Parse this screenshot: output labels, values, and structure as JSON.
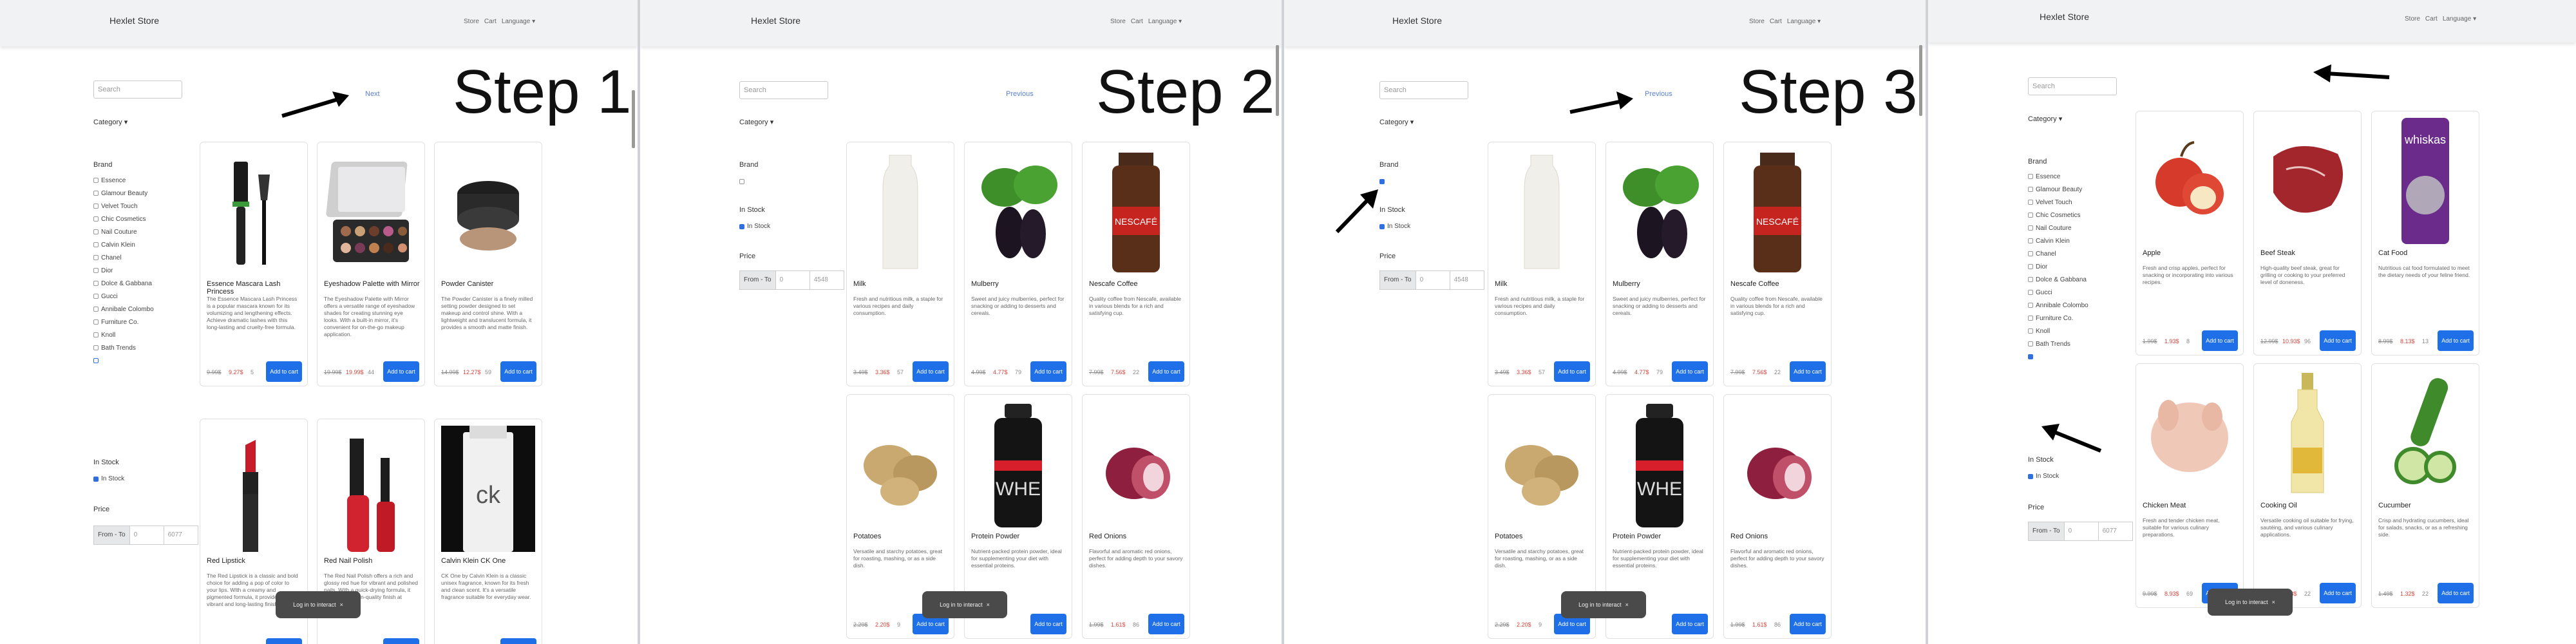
{
  "brand": "Hexlet Store",
  "menu": [
    "Store",
    "Cart",
    "Language ▾"
  ],
  "search_placeholder": "Search",
  "category_label": "Category ▾",
  "brand_label": "Brand",
  "instock_section": "In Stock",
  "instock_option": "In Stock",
  "price_label": "Price",
  "price_fromto": "From - To",
  "price_from": "0",
  "price_to_full": "6077",
  "price_to_filtered": "4548",
  "next_label": "Next",
  "previous_label": "Previous",
  "add_to_cart": "Add to cart",
  "toast_text": "Log in to interact",
  "toast_close": "×",
  "steps": [
    "Step 1",
    "Step 2",
    "Step 3"
  ],
  "brands": [
    "Essence",
    "Glamour Beauty",
    "Velvet Touch",
    "Chic Cosmetics",
    "Nail Couture",
    "Calvin Klein",
    "Chanel",
    "Dior",
    "Dolce & Gabbana",
    "Gucci",
    "Annibale Colombo",
    "Furniture Co.",
    "Knoll",
    "Bath Trends"
  ],
  "icon_names": [
    "search-icon",
    "chevron-down-icon",
    "checkbox-icon",
    "close-icon",
    "arrow-annotation-icon"
  ],
  "colors": {
    "accent": "#1e6fe8",
    "sale_price": "#d9433b",
    "navbar": "#f1f2f4",
    "toast": "#4a4a4a"
  },
  "panel1_products": [
    {
      "name": "Essence Mascara Lash Princess",
      "desc": "The Essence Mascara Lash Princess is a popular mascara known for its volumizing and lengthening effects. Achieve dramatic lashes with this long-lasting and cruelty-free formula.",
      "old": "9.99$",
      "new": "9.27$",
      "qty": "5",
      "img": "mascara"
    },
    {
      "name": "Eyeshadow Palette with Mirror",
      "desc": "The Eyeshadow Palette with Mirror offers a versatile range of eyeshadow shades for creating stunning eye looks. With a built-in mirror, it's convenient for on-the-go makeup application.",
      "old": "19.99$",
      "new": "19.99$",
      "qty": "44",
      "img": "palette"
    },
    {
      "name": "Powder Canister",
      "desc": "The Powder Canister is a finely milled setting powder designed to set makeup and control shine. With a lightweight and translucent formula, it provides a smooth and matte finish.",
      "old": "14.99$",
      "new": "12.27$",
      "qty": "59",
      "img": "powder"
    },
    {
      "name": "Red Lipstick",
      "desc": "The Red Lipstick is a classic and bold choice for adding a pop of color to your lips. With a creamy and pigmented formula, it provides a vibrant and long-lasting finish.",
      "old": "",
      "new": "",
      "qty": "",
      "img": "lipstick"
    },
    {
      "name": "Red Nail Polish",
      "desc": "The Red Nail Polish offers a rich and glossy red hue for vibrant and polished nails. With a quick-drying formula, it provides a salon-quality finish at home.",
      "old": "",
      "new": "",
      "qty": "",
      "img": "nailpolish"
    },
    {
      "name": "Calvin Klein CK One",
      "desc": "CK One by Calvin Klein is a classic unisex fragrance, known for its fresh and clean scent. It's a versatile fragrance suitable for everyday wear.",
      "old": "",
      "new": "",
      "qty": "",
      "img": "ckone"
    }
  ],
  "panel2_products": [
    {
      "name": "Milk",
      "desc": "Fresh and nutritious milk, a staple for various recipes and daily consumption.",
      "old": "3.49$",
      "new": "3.36$",
      "qty": "57",
      "img": "milk"
    },
    {
      "name": "Mulberry",
      "desc": "Sweet and juicy mulberries, perfect for snacking or adding to desserts and cereals.",
      "old": "4.99$",
      "new": "4.77$",
      "qty": "79",
      "img": "mulberry"
    },
    {
      "name": "Nescafe Coffee",
      "desc": "Quality coffee from Nescafe, available in various blends for a rich and satisfying cup.",
      "old": "7.99$",
      "new": "7.56$",
      "qty": "22",
      "img": "coffee"
    },
    {
      "name": "Potatoes",
      "desc": "Versatile and starchy potatoes, great for roasting, mashing, or as a side dish.",
      "old": "2.29$",
      "new": "2.20$",
      "qty": "9",
      "img": "potatoes"
    },
    {
      "name": "Protein Powder",
      "desc": "Nutrient-packed protein powder, ideal for supplementing your diet with essential proteins.",
      "old": "",
      "new": "",
      "qty": "",
      "img": "protein"
    },
    {
      "name": "Red Onions",
      "desc": "Flavorful and aromatic red onions, perfect for adding depth to your savory dishes.",
      "old": "1.99$",
      "new": "1.61$",
      "qty": "86",
      "img": "onion"
    }
  ],
  "panel4_products": [
    {
      "name": "Apple",
      "desc": "Fresh and crisp apples, perfect for snacking or incorporating into various recipes.",
      "old": "1.99$",
      "new": "1.93$",
      "qty": "8",
      "img": "apple"
    },
    {
      "name": "Beef Steak",
      "desc": "High-quality beef steak, great for grilling or cooking to your preferred level of doneness.",
      "old": "12.99$",
      "new": "10.93$",
      "qty": "96",
      "img": "steak"
    },
    {
      "name": "Cat Food",
      "desc": "Nutritious cat food formulated to meet the dietary needs of your feline friend.",
      "old": "8.99$",
      "new": "8.13$",
      "qty": "13",
      "img": "catfood"
    },
    {
      "name": "Chicken Meat",
      "desc": "Fresh and tender chicken meat, suitable for various culinary preparations.",
      "old": "9.99$",
      "new": "8.93$",
      "qty": "69",
      "img": "chicken"
    },
    {
      "name": "Cooking Oil",
      "desc": "Versatile cooking oil suitable for frying, sautéing, and various culinary applications.",
      "old": "4.99$",
      "new": "4.03$",
      "qty": "22",
      "img": "oil"
    },
    {
      "name": "Cucumber",
      "desc": "Crisp and hydrating cucumbers, ideal for salads, snacks, or as a refreshing side.",
      "old": "1.49$",
      "new": "1.32$",
      "qty": "22",
      "img": "cucumber"
    }
  ]
}
